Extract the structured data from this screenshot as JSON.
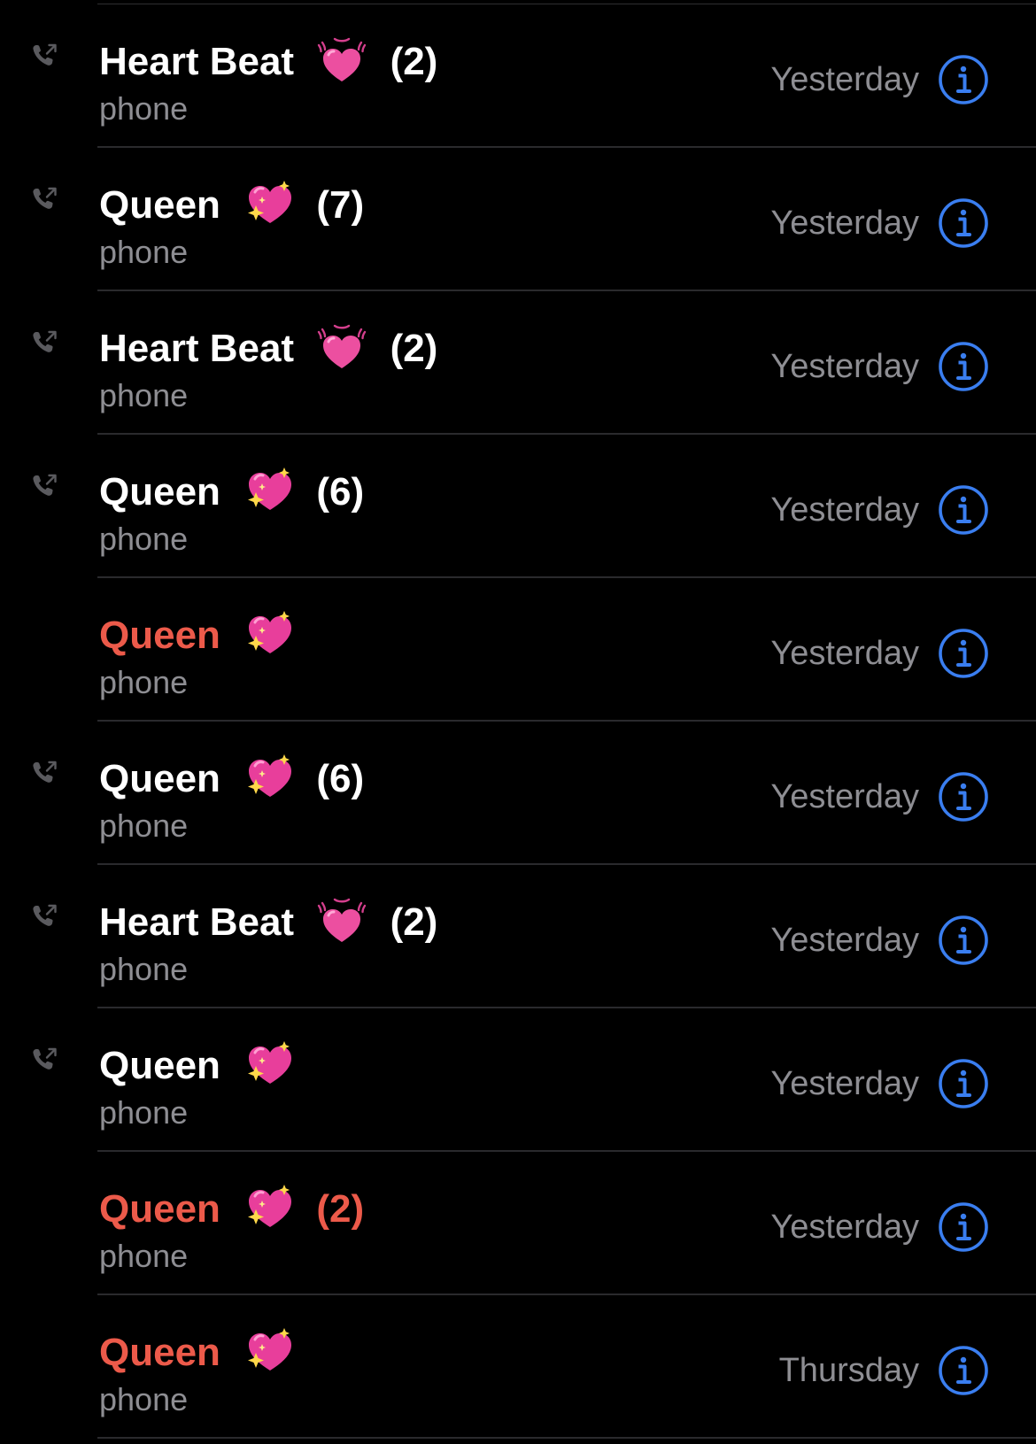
{
  "colors": {
    "background": "#000000",
    "name_text": "#ffffff",
    "missed_text": "#ec5a4a",
    "secondary_text": "#8e8e93",
    "accent_info": "#3a7ef0",
    "divider": "#2a2a2d"
  },
  "recents": [
    {
      "name": "Heart Beat",
      "emoji": "beating-heart-emoji",
      "count": "(2)",
      "label": "phone",
      "time": "Yesterday",
      "missed": false,
      "outgoing": true
    },
    {
      "name": "Queen",
      "emoji": "sparkling-heart-emoji",
      "count": "(7)",
      "label": "phone",
      "time": "Yesterday",
      "missed": false,
      "outgoing": true
    },
    {
      "name": "Heart Beat",
      "emoji": "beating-heart-emoji",
      "count": "(2)",
      "label": "phone",
      "time": "Yesterday",
      "missed": false,
      "outgoing": true
    },
    {
      "name": "Queen",
      "emoji": "sparkling-heart-emoji",
      "count": "(6)",
      "label": "phone",
      "time": "Yesterday",
      "missed": false,
      "outgoing": true
    },
    {
      "name": "Queen",
      "emoji": "sparkling-heart-emoji",
      "count": "",
      "label": "phone",
      "time": "Yesterday",
      "missed": true,
      "outgoing": false
    },
    {
      "name": "Queen",
      "emoji": "sparkling-heart-emoji",
      "count": "(6)",
      "label": "phone",
      "time": "Yesterday",
      "missed": false,
      "outgoing": true
    },
    {
      "name": "Heart Beat",
      "emoji": "beating-heart-emoji",
      "count": "(2)",
      "label": "phone",
      "time": "Yesterday",
      "missed": false,
      "outgoing": true
    },
    {
      "name": "Queen",
      "emoji": "sparkling-heart-emoji",
      "count": "",
      "label": "phone",
      "time": "Yesterday",
      "missed": false,
      "outgoing": true
    },
    {
      "name": "Queen",
      "emoji": "sparkling-heart-emoji",
      "count": "(2)",
      "label": "phone",
      "time": "Yesterday",
      "missed": true,
      "outgoing": false
    },
    {
      "name": "Queen",
      "emoji": "sparkling-heart-emoji",
      "count": "",
      "label": "phone",
      "time": "Thursday",
      "missed": true,
      "outgoing": false
    }
  ]
}
